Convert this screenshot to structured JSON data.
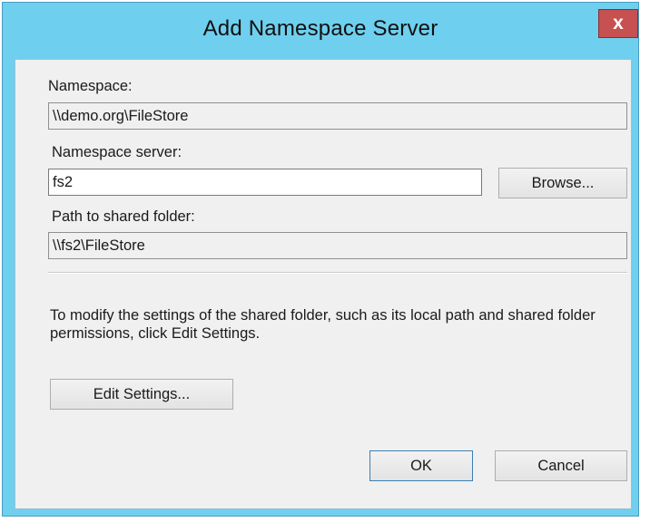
{
  "dialog": {
    "title": "Add Namespace Server",
    "close_glyph": "x",
    "namespace_label": "Namespace:",
    "namespace_value": "\\\\demo.org\\FileStore",
    "namespace_server_label": "Namespace server:",
    "namespace_server_value": "fs2",
    "browse_label": "Browse...",
    "path_label": "Path to shared folder:",
    "path_value": "\\\\fs2\\FileStore",
    "info_text": "To modify the settings of the shared folder, such as its local path and shared folder permissions, click Edit Settings.",
    "edit_settings_label": "Edit Settings...",
    "ok_label": "OK",
    "cancel_label": "Cancel"
  },
  "colors": {
    "title_bar": "#6fcfee",
    "close_button": "#c75050",
    "client_area": "#f0f0f0"
  }
}
